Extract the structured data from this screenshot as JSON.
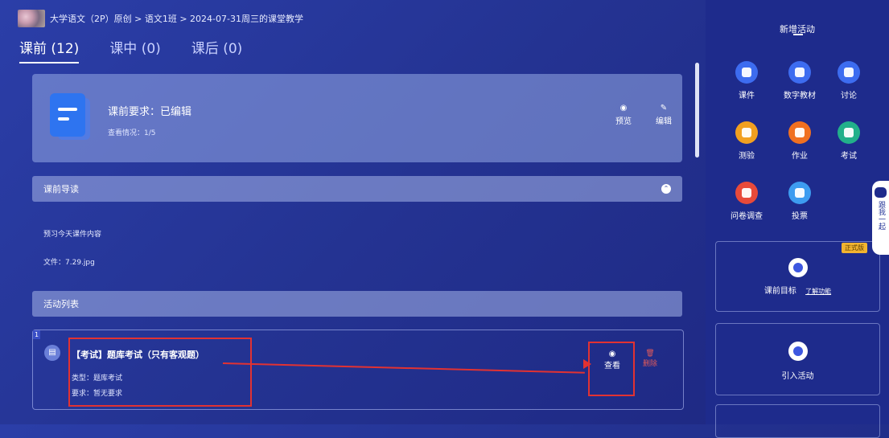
{
  "breadcrumb": "大学语文（2P）原创 > 语文1班 > 2024-07-31周三的课堂教学",
  "tabs": [
    {
      "label": "课前 (12)",
      "active": true
    },
    {
      "label": "课中 (0)",
      "active": false
    },
    {
      "label": "课后 (0)",
      "active": false
    }
  ],
  "requirement": {
    "title": "课前要求：已编辑",
    "view_status": "查看情况：1/5",
    "preview_label": "预览",
    "edit_label": "编辑"
  },
  "guide": {
    "header": "课前导读",
    "content": "预习今天课件内容",
    "file": "文件：7.29.jpg"
  },
  "activity_list": {
    "header": "活动列表",
    "items": [
      {
        "index": "1",
        "title": "【考试】题库考试（只有客观题）",
        "type": "类型：题库考试",
        "requirement": "要求：暂无要求",
        "view_label": "查看",
        "delete_label": "删除"
      }
    ]
  },
  "sidebar": {
    "title": "新增活动",
    "items": [
      {
        "label": "课件",
        "color": "#3d6cf0"
      },
      {
        "label": "数字教材",
        "color": "#3d6cf0"
      },
      {
        "label": "讨论",
        "color": "#3d6cf0"
      },
      {
        "label": "测验",
        "color": "#f2a020"
      },
      {
        "label": "作业",
        "color": "#f07020"
      },
      {
        "label": "考试",
        "color": "#22b08a"
      },
      {
        "label": "问卷调查",
        "color": "#e84a3a"
      },
      {
        "label": "投票",
        "color": "#3d9cf0"
      }
    ],
    "goal_label": "课前目标",
    "learn_label": "了解功能",
    "import_label": "引入活动",
    "badge": "正式版",
    "float_label": "跟我一起"
  }
}
